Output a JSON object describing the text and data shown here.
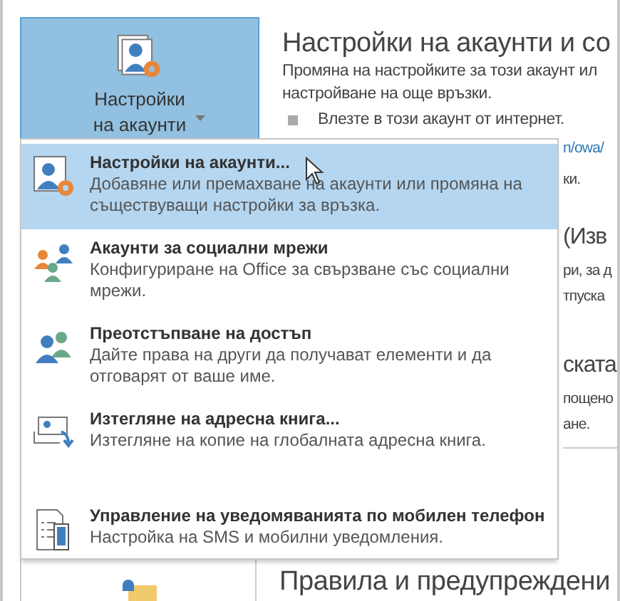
{
  "account_button": {
    "label_lines": [
      "Настройки",
      "на акаунти"
    ],
    "expanded": true
  },
  "heading": "Настройки на акаунти и со",
  "description_lines": [
    "Промяна на настройките за този акаунт ил",
    "настройване на още връзки."
  ],
  "bullet": "Влезте в този акаунт от интернет.",
  "covered_fragments": [
    {
      "text": "n/owa/",
      "kind": "link"
    },
    {
      "text": "ки.",
      "kind": "text"
    },
    {
      "text": "(Изв",
      "kind": "heading"
    },
    {
      "text": "ри, за д",
      "kind": "text"
    },
    {
      "text": "тпуска",
      "kind": "text"
    },
    {
      "text": "ската",
      "kind": "heading"
    },
    {
      "text": "пощено",
      "kind": "text"
    },
    {
      "text": "ане.",
      "kind": "text"
    }
  ],
  "menu": {
    "items": [
      {
        "kind": "account-settings",
        "title": "Настройки на акаунти...",
        "description": "Добавяне или премахване на акаунти или промяна на съществуващи настройки за връзка.",
        "selected": true
      },
      {
        "kind": "social",
        "title": "Акаунти за социални мрежи",
        "description": "Конфигуриране на Office за свързване със социални мрежи.",
        "selected": false
      },
      {
        "kind": "delegate",
        "title": "Преотстъпване на достъп",
        "description": "Дайте права на други да получават елементи и да отговарят от ваше име.",
        "selected": false
      },
      {
        "kind": "address-book",
        "title": "Изтегляне на адресна книга...",
        "description": "Изтегляне на копие на глобалната адресна книга.",
        "selected": false
      },
      {
        "kind": "mobile",
        "title": "Управление на уведомяванията по мобилен телефон",
        "description": "Настройка на SMS и мобилни уведомления.",
        "selected": false
      }
    ]
  },
  "rules_heading": "Правила и предупреждени"
}
